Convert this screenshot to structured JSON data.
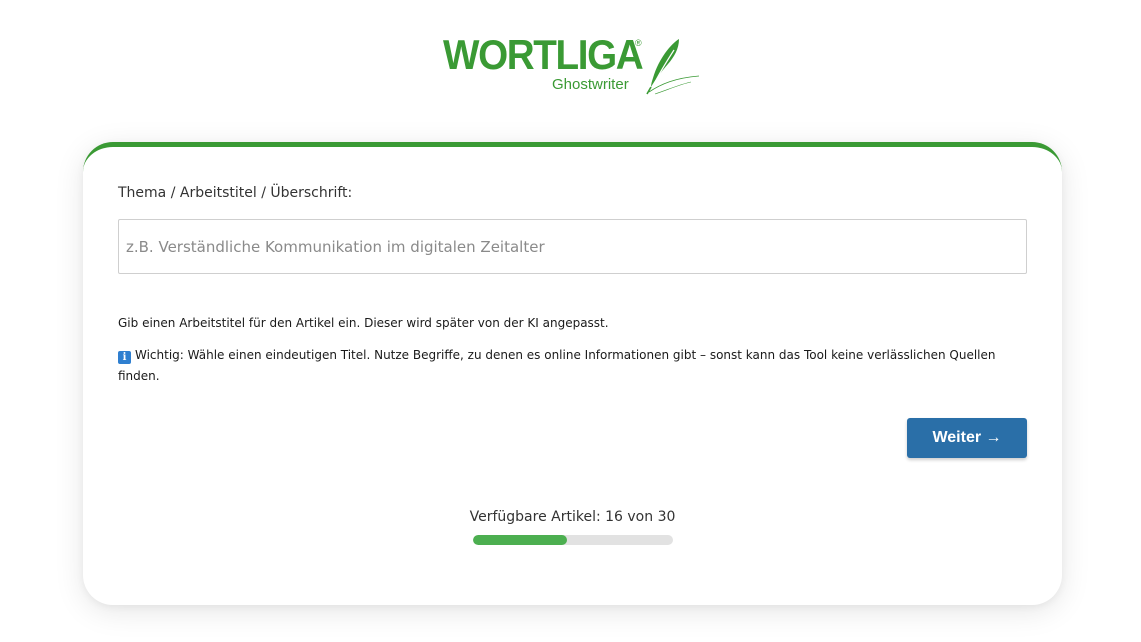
{
  "logo": {
    "wordmark": "WORTLIGA",
    "registered": "®",
    "subtitle": "Ghostwriter",
    "quill_icon": "feather-quill-icon"
  },
  "form": {
    "label": "Thema / Arbeitstitel / Überschrift:",
    "input_value": "",
    "input_placeholder": "z.B. Verständliche Kommunikation im digitalen Zeitalter",
    "help_text": "Gib einen Arbeitstitel für den Artikel ein. Dieser wird später von der KI angepasst.",
    "note_icon": "info-icon",
    "note_icon_glyph": "i",
    "note_text": "Wichtig: Wähle einen eindeutigen Titel. Nutze Begriffe, zu denen es online Informationen gibt – sonst kann das Tool keine verlässlichen Quellen finden.",
    "next_label": "Weiter →"
  },
  "quota": {
    "label": "Verfügbare Artikel: 16 von 30",
    "used": 16,
    "total": 30,
    "fill_fraction": 0.47
  },
  "colors": {
    "brand_green": "#3a9a34",
    "progress_green": "#4caf50",
    "button_blue": "#2a6fa8",
    "info_blue": "#2f7fd0"
  }
}
